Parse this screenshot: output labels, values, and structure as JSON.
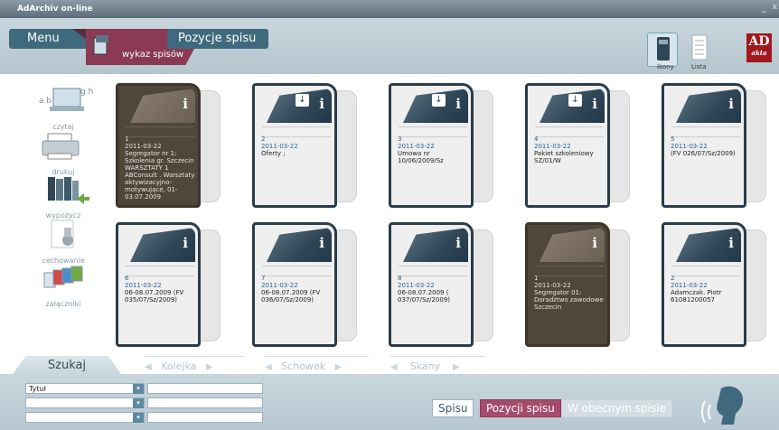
{
  "window": {
    "title": "AdArchiv on-line",
    "minimize": "_",
    "close": "x"
  },
  "header": {
    "menu_label": "Menu",
    "pozycje_label": "Pozycje spisu",
    "ribbon_label": "wykaz spisów",
    "views": [
      {
        "label": "Ikony",
        "active": true
      },
      {
        "label": "Lista",
        "active": false
      }
    ],
    "logo": {
      "main": "AD",
      "sub": "akta"
    }
  },
  "sidebar": {
    "items": [
      {
        "label": "czytaj",
        "icon": "reading-icon"
      },
      {
        "label": "drukuj",
        "icon": "printer-icon"
      },
      {
        "label": "wypożycz",
        "icon": "books-icon"
      },
      {
        "label": "cechowanie",
        "icon": "stamp-icon"
      },
      {
        "label": "załączniki",
        "icon": "attachments-icon"
      }
    ]
  },
  "binders": [
    {
      "number": "1",
      "date": "2011-03-22",
      "text": "Segregator nr 1: Szkolenia gr. Szczecin WARSZTATY 1 ABConsult . Warsztaty aktywizacyjno-motywujące, 01-03.07.2009",
      "dark": true,
      "download": false
    },
    {
      "number": "2",
      "date": "2011-03-22",
      "text": "Oferty ;",
      "dark": false,
      "download": true
    },
    {
      "number": "3",
      "date": "2011-03-22",
      "text": "Umowa nr 10/06/2009/Sz",
      "dark": false,
      "download": true
    },
    {
      "number": "4",
      "date": "2011-03-22",
      "text": "Pakiet szkoleniowy SZ/01/W",
      "dark": false,
      "download": true
    },
    {
      "number": "5",
      "date": "2011-03-22",
      "text": "(FV 026/07/Sz/2009)",
      "dark": false,
      "download": false
    },
    {
      "number": "6",
      "date": "2011-03-22",
      "text": "06-08.07.2009 (FV 035/07/Sz/2009)",
      "dark": false,
      "download": false
    },
    {
      "number": "7",
      "date": "2011-03-22",
      "text": "06-08.07.2009 (FV 036/07/Sz/2009)",
      "dark": false,
      "download": false
    },
    {
      "number": "8",
      "date": "2011-03-22",
      "text": "06-08.07.2009 ( 037/07/Sz/2009)",
      "dark": false,
      "download": false
    },
    {
      "number": "1",
      "date": "2011-03-22",
      "text": "Segregator 01: Doradztwo zawodowe Szczecin",
      "dark": true,
      "download": false
    },
    {
      "number": "2",
      "date": "2011-03-22",
      "text": "Adamczak. Piotr 61081200057",
      "dark": false,
      "download": false
    }
  ],
  "footer": {
    "tabs": [
      "Szukaj",
      "Kolejka",
      "Schowek",
      "Skany"
    ],
    "search_fields": [
      {
        "select": "Tytuł",
        "value": ""
      },
      {
        "select": "",
        "value": ""
      },
      {
        "select": "",
        "value": ""
      }
    ],
    "buttons": {
      "spisu": "Spisu",
      "pozycji": "Pozycji spisu",
      "obecnym": "W obecnym spisie"
    }
  },
  "icon_glyphs": {
    "info": "i",
    "download": "↓",
    "left": "◀",
    "right": "▶",
    "dropdown": "▾"
  }
}
